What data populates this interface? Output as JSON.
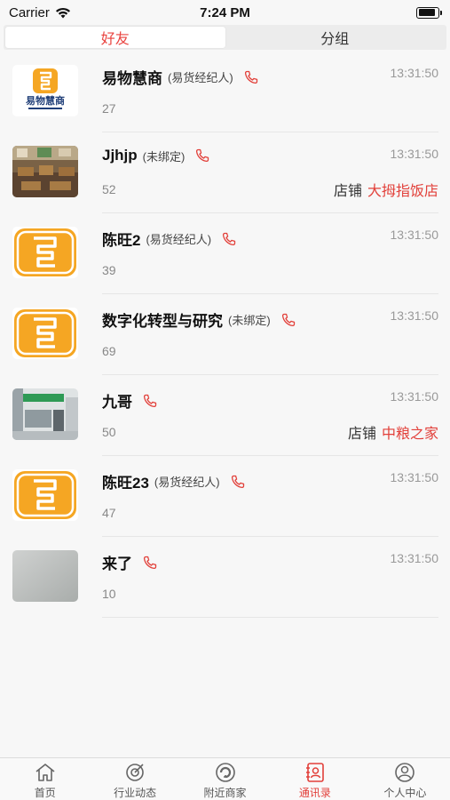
{
  "status_bar": {
    "carrier": "Carrier",
    "time": "7:24 PM",
    "battery_level": 0.9
  },
  "segments": [
    {
      "label": "好友",
      "active": true
    },
    {
      "label": "分组",
      "active": false
    }
  ],
  "contacts": [
    {
      "name": "易物慧商",
      "role": "(易货经纪人)",
      "time": "13:31:50",
      "id": "27",
      "avatar": "logo-with-text",
      "logo_caption": "易物慧商",
      "store_label": "",
      "store_name": ""
    },
    {
      "name": "Jjhjp",
      "role": "(未绑定)",
      "time": "13:31:50",
      "id": "52",
      "avatar": "photo-restaurant",
      "store_label": "店铺",
      "store_name": "大拇指饭店"
    },
    {
      "name": "陈旺2",
      "role": "(易货经纪人)",
      "time": "13:31:50",
      "id": "39",
      "avatar": "logo",
      "store_label": "",
      "store_name": ""
    },
    {
      "name": "数字化转型与研究",
      "role": "(未绑定)",
      "time": "13:31:50",
      "id": "69",
      "avatar": "logo",
      "store_label": "",
      "store_name": ""
    },
    {
      "name": "九哥",
      "role": "",
      "time": "13:31:50",
      "id": "50",
      "avatar": "photo-shop",
      "store_label": "店铺",
      "store_name": "中粮之家"
    },
    {
      "name": "陈旺23",
      "role": "(易货经纪人)",
      "time": "13:31:50",
      "id": "47",
      "avatar": "logo",
      "store_label": "",
      "store_name": ""
    },
    {
      "name": "来了",
      "role": "",
      "time": "13:31:50",
      "id": "10",
      "avatar": "photo-grey",
      "store_label": "",
      "store_name": ""
    }
  ],
  "tab_bar": [
    {
      "label": "首页",
      "icon": "home-icon",
      "active": false
    },
    {
      "label": "行业动态",
      "icon": "trend-icon",
      "active": false
    },
    {
      "label": "附近商家",
      "icon": "nearby-icon",
      "active": false
    },
    {
      "label": "通讯录",
      "icon": "contacts-icon",
      "active": true
    },
    {
      "label": "个人中心",
      "icon": "profile-icon",
      "active": false
    }
  ],
  "colors": {
    "accent": "#e2403a",
    "logo_orange": "#f5a623"
  }
}
